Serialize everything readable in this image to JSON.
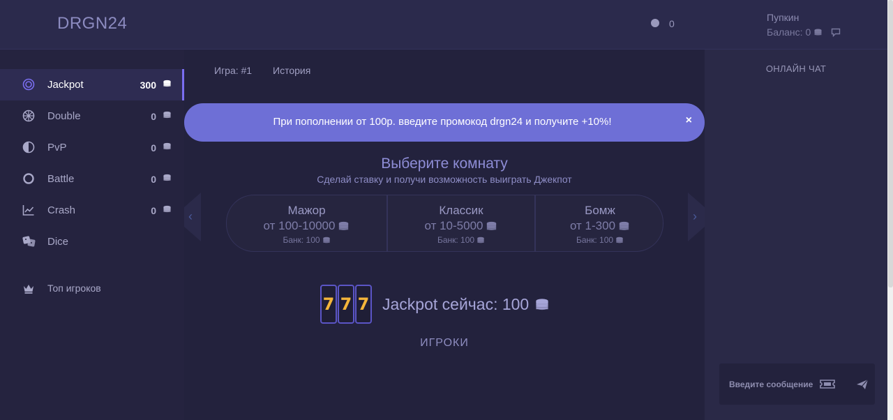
{
  "header": {
    "logo": "DRGN24",
    "online_count": "0",
    "user_name": "Пупкин",
    "balance_label": "Баланс: 0"
  },
  "sidebar": {
    "items": [
      {
        "label": "Jackpot",
        "count": "300",
        "icon": "target-icon"
      },
      {
        "label": "Double",
        "count": "0",
        "icon": "wheel-icon"
      },
      {
        "label": "PvP",
        "count": "0",
        "icon": "half-circle-icon"
      },
      {
        "label": "Battle",
        "count": "0",
        "icon": "ring-icon"
      },
      {
        "label": "Crash",
        "count": "0",
        "icon": "chart-icon"
      },
      {
        "label": "Dice",
        "count": "",
        "icon": "dice-icon"
      }
    ],
    "top_players": "Топ игроков"
  },
  "main": {
    "tabs": [
      "Игра: #1",
      "История"
    ],
    "promo": "При пополнении от 100р. введите промокод drgn24 и получите +10%!",
    "promo_close": "×",
    "room_title": "Выберите комнату",
    "room_subtitle": "Сделай ставку и получи возможность выиграть Джекпот",
    "rooms": [
      {
        "name": "Мажор",
        "range": "от 100-10000",
        "bank": "Банк: 100"
      },
      {
        "name": "Классик",
        "range": "от 10-5000",
        "bank": "Банк: 100"
      },
      {
        "name": "Бомж",
        "range": "от 1-300",
        "bank": "Банк: 100"
      }
    ],
    "slot_digits": [
      "7",
      "7",
      "7"
    ],
    "jackpot_text": "Jackpot сейчас: 100",
    "players_title": "ИГРОКИ"
  },
  "chat": {
    "title": "ОНЛАЙН ЧАТ",
    "placeholder": "Введите сообщение"
  },
  "colors": {
    "accent": "#7a6ef0",
    "promo_bg": "#6e6fd6",
    "background": "#23223d",
    "slot_digit": "#f4b53a"
  }
}
